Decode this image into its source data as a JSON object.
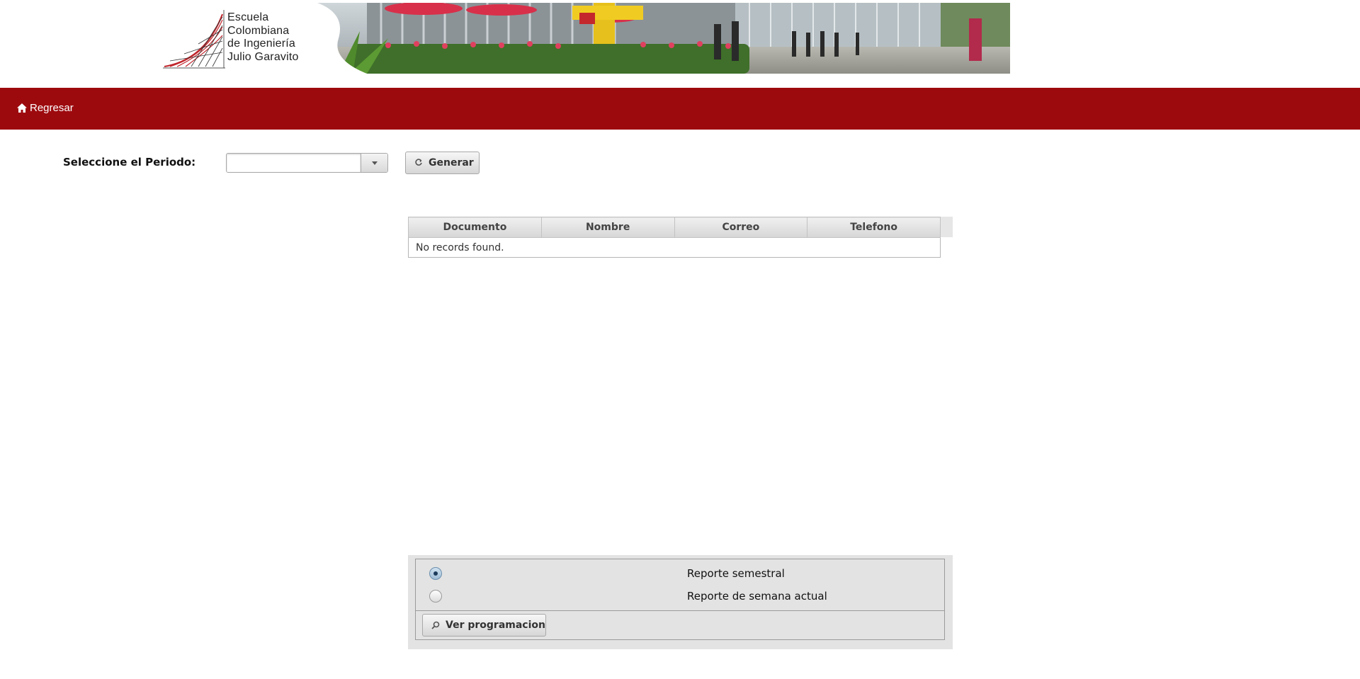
{
  "header": {
    "logo_lines": [
      "Escuela",
      "Colombiana",
      "de Ingeniería",
      "Julio Garavito"
    ]
  },
  "nav": {
    "back_label": "Regresar",
    "back_icon": "home-icon"
  },
  "period": {
    "label": "Seleccione el Periodo:",
    "value": "",
    "generate_label": "Generar",
    "generate_icon": "refresh-icon"
  },
  "table": {
    "columns": [
      "Documento",
      "Nombre",
      "Correo",
      "Telefono"
    ],
    "empty_message": "No records found."
  },
  "report": {
    "options": [
      {
        "label": "Reporte semestral",
        "checked": true
      },
      {
        "label": "Reporte de semana actual",
        "checked": false
      }
    ],
    "view_label": "Ver programacion",
    "view_icon": "search-icon"
  },
  "colors": {
    "navbar": "#9d0a0e",
    "panel": "#e3e3e3"
  }
}
